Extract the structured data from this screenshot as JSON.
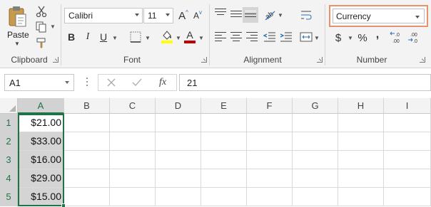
{
  "ribbon": {
    "clipboard": {
      "group_label": "Clipboard",
      "paste_label": "Paste"
    },
    "font": {
      "group_label": "Font",
      "font_name": "Calibri",
      "font_size": "11",
      "bold_label": "B",
      "italic_label": "I",
      "underline_label": "U",
      "font_color": "#c00000",
      "highlight_color": "#ffff00"
    },
    "alignment": {
      "group_label": "Alignment"
    },
    "number": {
      "group_label": "Number",
      "format_value": "Currency",
      "currency_symbol": "$",
      "percent_symbol": "%",
      "comma_symbol": ",",
      "increase_decimal": ".00",
      "decrease_decimal": ".0"
    }
  },
  "formula_bar": {
    "name_box": "A1",
    "function_label": "fx",
    "value": "21"
  },
  "sheet": {
    "columns": [
      "A",
      "B",
      "C",
      "D",
      "E",
      "F",
      "G",
      "H",
      "I"
    ],
    "rows": [
      "1",
      "2",
      "3",
      "4",
      "5"
    ],
    "cells_A": [
      "$21.00",
      "$33.00",
      "$16.00",
      "$29.00",
      "$15.00"
    ],
    "selection_color": "#217346"
  }
}
